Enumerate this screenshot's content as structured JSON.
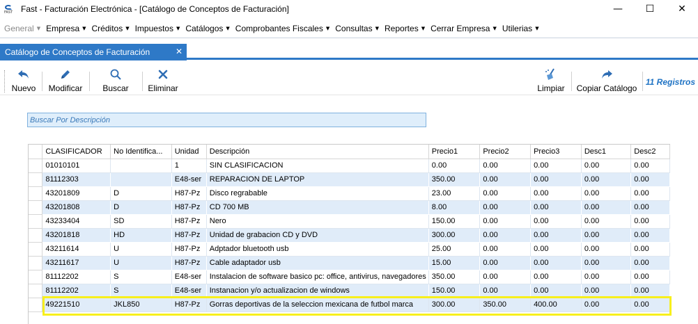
{
  "window": {
    "app_icon_text": "FAST",
    "title": "Fast - Facturación Electrónica - [Catálogo de Conceptos de Facturación]",
    "controls": {
      "minimize": "—",
      "maximize": "☐",
      "close": "✕"
    }
  },
  "menu": {
    "items": [
      {
        "label": "General",
        "disabled": true
      },
      {
        "label": "Empresa"
      },
      {
        "label": "Créditos"
      },
      {
        "label": "Impuestos"
      },
      {
        "label": "Catálogos"
      },
      {
        "label": "Comprobantes Fiscales"
      },
      {
        "label": "Consultas"
      },
      {
        "label": "Reportes"
      },
      {
        "label": "Cerrar Empresa"
      },
      {
        "label": "Utilerias"
      }
    ],
    "caret": "▼"
  },
  "tab": {
    "label": "Catálogo de Conceptos de Facturación",
    "close": "✕"
  },
  "toolbar": {
    "nuevo": "Nuevo",
    "modificar": "Modificar",
    "buscar": "Buscar",
    "eliminar": "Eliminar",
    "limpiar": "Limpiar",
    "copiar": "Copiar Catálogo",
    "registros": "11 Registros"
  },
  "search": {
    "placeholder": "Buscar Por Descripción",
    "value": ""
  },
  "grid": {
    "columns": [
      "CLASIFICADOR",
      "No Identifica...",
      "Unidad",
      "Descripción",
      "Precio1",
      "Precio2",
      "Precio3",
      "Desc1",
      "Desc2"
    ],
    "rows": [
      [
        "01010101",
        "",
        "1",
        "SIN CLASIFICACION",
        "0.00",
        "0.00",
        "0.00",
        "0.00",
        "0.00"
      ],
      [
        "81112303",
        "",
        "E48-ser",
        "REPARACION DE LAPTOP",
        "350.00",
        "0.00",
        "0.00",
        "0.00",
        "0.00"
      ],
      [
        "43201809",
        "D",
        "H87-Pz",
        "Disco regrabable",
        "23.00",
        "0.00",
        "0.00",
        "0.00",
        "0.00"
      ],
      [
        "43201808",
        "D",
        "H87-Pz",
        "CD 700 MB",
        "8.00",
        "0.00",
        "0.00",
        "0.00",
        "0.00"
      ],
      [
        "43233404",
        "SD",
        "H87-Pz",
        "Nero",
        "150.00",
        "0.00",
        "0.00",
        "0.00",
        "0.00"
      ],
      [
        "43201818",
        "HD",
        "H87-Pz",
        "Unidad de grabacion CD y DVD",
        "300.00",
        "0.00",
        "0.00",
        "0.00",
        "0.00"
      ],
      [
        "43211614",
        "U",
        "H87-Pz",
        "Adptador bluetooth usb",
        "25.00",
        "0.00",
        "0.00",
        "0.00",
        "0.00"
      ],
      [
        "43211617",
        "U",
        "H87-Pz",
        "Cable adaptador usb",
        "15.00",
        "0.00",
        "0.00",
        "0.00",
        "0.00"
      ],
      [
        "81112202",
        "S",
        "E48-ser",
        "Instalacion de software basico pc: office, antivirus, navegadores",
        "350.00",
        "0.00",
        "0.00",
        "0.00",
        "0.00"
      ],
      [
        "81112202",
        "S",
        "E48-ser",
        "Instanacion y/o actualizacion de windows",
        "150.00",
        "0.00",
        "0.00",
        "0.00",
        "0.00"
      ],
      [
        "49221510",
        "JKL850",
        "H87-Pz",
        "Gorras deportivas de la seleccion mexicana de futbol marca",
        "300.00",
        "350.00",
        "400.00",
        "0.00",
        "0.00"
      ]
    ],
    "highlighted_row": 10
  },
  "colors": {
    "accent": "#2e79c7",
    "row_alt": "#e0ecf9",
    "highlight_border": "#f7ef1c",
    "registros_text": "#1f73c4"
  }
}
